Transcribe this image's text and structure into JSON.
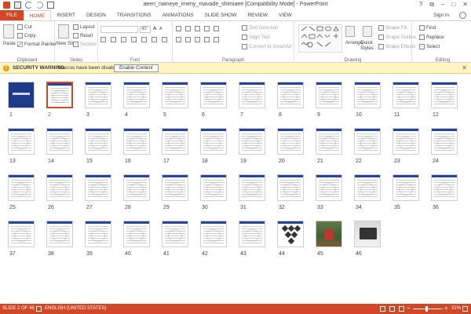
{
  "window_title": "aeen_nameye_imeny_mavade_shimiaee [Compatibility Mode] - PowerPoint",
  "window_controls": {
    "help": "?",
    "ribbon_opts": "⧉",
    "minimize": "–",
    "maximize": "□",
    "close": "✕"
  },
  "tabs": [
    "FILE",
    "HOME",
    "INSERT",
    "DESIGN",
    "TRANSITIONS",
    "ANIMATIONS",
    "SLIDE SHOW",
    "REVIEW",
    "VIEW"
  ],
  "active_tab": "HOME",
  "sign_in": "Sign in",
  "ribbon": {
    "clipboard": {
      "label": "Clipboard",
      "paste": "Paste",
      "cut": "Cut",
      "copy": "Copy",
      "format_painter": "Format Painter"
    },
    "slides": {
      "label": "Slides",
      "new_slide": "New Slide",
      "layout": "Layout",
      "reset": "Reset",
      "section": "Section"
    },
    "font": {
      "label": "Font",
      "font_name": "",
      "font_size": "40",
      "grow": "A",
      "shrink": "A"
    },
    "paragraph": {
      "label": "Paragraph",
      "text_direction": "Text Direction",
      "align_text": "Align Text",
      "convert_smartart": "Convert to SmartArt"
    },
    "drawing": {
      "label": "Drawing",
      "arrange": "Arrange",
      "quick_styles": "Quick Styles",
      "shape_fill": "Shape Fill",
      "shape_outline": "Shape Outline",
      "shape_effects": "Shape Effects"
    },
    "editing": {
      "label": "Editing",
      "find": "Find",
      "replace": "Replace",
      "select": "Select"
    }
  },
  "security_bar": {
    "title": "SECURITY WARNING",
    "message": "Macros have been disabled.",
    "button": "Enable Content",
    "close": "✕"
  },
  "slides": [
    {
      "number": "1",
      "kind": "title"
    },
    {
      "number": "2",
      "kind": "text",
      "selected": true
    },
    {
      "number": "3",
      "kind": "text"
    },
    {
      "number": "4",
      "kind": "text"
    },
    {
      "number": "5",
      "kind": "text"
    },
    {
      "number": "6",
      "kind": "text"
    },
    {
      "number": "7",
      "kind": "text"
    },
    {
      "number": "8",
      "kind": "text"
    },
    {
      "number": "9",
      "kind": "text"
    },
    {
      "number": "10",
      "kind": "text"
    },
    {
      "number": "11",
      "kind": "text"
    },
    {
      "number": "12",
      "kind": "text"
    },
    {
      "number": "13",
      "kind": "text"
    },
    {
      "number": "14",
      "kind": "text"
    },
    {
      "number": "15",
      "kind": "text"
    },
    {
      "number": "16",
      "kind": "text"
    },
    {
      "number": "17",
      "kind": "text"
    },
    {
      "number": "18",
      "kind": "text"
    },
    {
      "number": "19",
      "kind": "text"
    },
    {
      "number": "20",
      "kind": "text"
    },
    {
      "number": "21",
      "kind": "text"
    },
    {
      "number": "22",
      "kind": "text"
    },
    {
      "number": "23",
      "kind": "text"
    },
    {
      "number": "24",
      "kind": "text"
    },
    {
      "number": "25",
      "kind": "text"
    },
    {
      "number": "26",
      "kind": "text"
    },
    {
      "number": "27",
      "kind": "text"
    },
    {
      "number": "28",
      "kind": "text"
    },
    {
      "number": "29",
      "kind": "text"
    },
    {
      "number": "30",
      "kind": "text"
    },
    {
      "number": "31",
      "kind": "text"
    },
    {
      "number": "32",
      "kind": "text"
    },
    {
      "number": "33",
      "kind": "text"
    },
    {
      "number": "34",
      "kind": "text"
    },
    {
      "number": "35",
      "kind": "text"
    },
    {
      "number": "36",
      "kind": "text"
    },
    {
      "number": "37",
      "kind": "text"
    },
    {
      "number": "38",
      "kind": "text"
    },
    {
      "number": "39",
      "kind": "text"
    },
    {
      "number": "40",
      "kind": "text"
    },
    {
      "number": "41",
      "kind": "text"
    },
    {
      "number": "42",
      "kind": "text"
    },
    {
      "number": "43",
      "kind": "text"
    },
    {
      "number": "44",
      "kind": "diagram"
    },
    {
      "number": "45",
      "kind": "photo-red"
    },
    {
      "number": "46",
      "kind": "photo-laptop"
    }
  ],
  "status": {
    "slide_indicator": "SLIDE 2 OF 46",
    "language": "ENGLISH (UNITED STATES)",
    "zoom_minus": "−",
    "zoom_plus": "+",
    "zoom_level": "31%"
  },
  "colors": {
    "accent": "#d24726",
    "warning_bg": "#fff4c2",
    "slide_header": "#27449c"
  }
}
